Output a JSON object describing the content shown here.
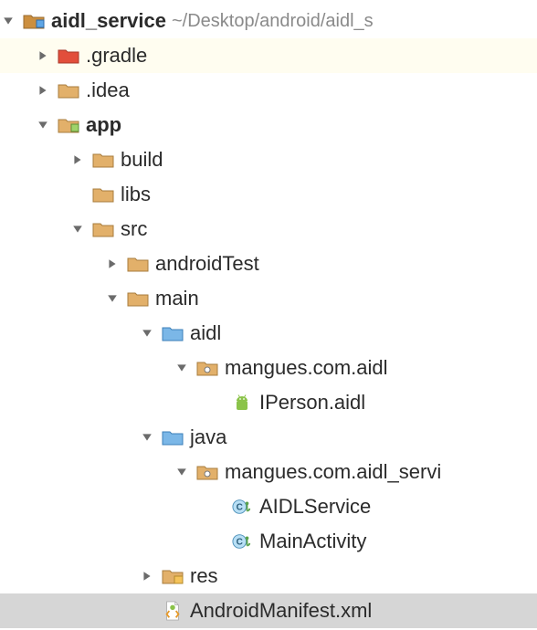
{
  "root": {
    "name": "aidl_service",
    "path": "~/Desktop/android/aidl_s"
  },
  "gradle_dir": ".gradle",
  "idea_dir": ".idea",
  "app_module": "app",
  "build_dir": "build",
  "libs_dir": "libs",
  "src_dir": "src",
  "androidTest_dir": "androidTest",
  "main_dir": "main",
  "aidl_dir": "aidl",
  "aidl_pkg": "mangues.com.aidl",
  "aidl_file": "IPerson.aidl",
  "java_dir": "java",
  "java_pkg": "mangues.com.aidl_servi",
  "aidl_service_class": "AIDLService",
  "main_activity_class": "MainActivity",
  "res_dir": "res",
  "manifest_file": "AndroidManifest.xml"
}
